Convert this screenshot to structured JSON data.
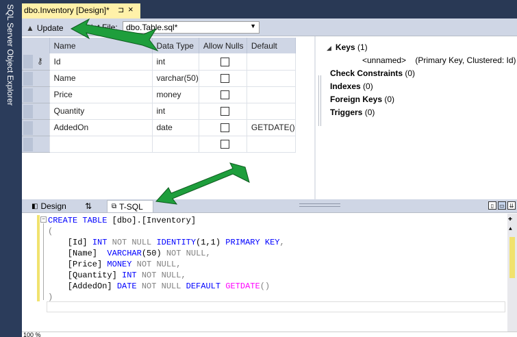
{
  "side_panel": {
    "title": "SQL Server Object Explorer"
  },
  "document_tab": {
    "title": "dbo.Inventory [Design]*",
    "pin_icon": "pin-icon",
    "close_icon": "close-icon"
  },
  "toolbar": {
    "update_label": "Update",
    "script_file_label": "Script File:",
    "script_file_value": "dbo.Table.sql*"
  },
  "design_grid": {
    "headers": [
      "Name",
      "Data Type",
      "Allow Nulls",
      "Default"
    ],
    "rows": [
      {
        "name": "Id",
        "type": "int",
        "allow_nulls": false,
        "default": "",
        "key": true
      },
      {
        "name": "Name",
        "type": "varchar(50)",
        "allow_nulls": false,
        "default": "",
        "key": false
      },
      {
        "name": "Price",
        "type": "money",
        "allow_nulls": false,
        "default": "",
        "key": false
      },
      {
        "name": "Quantity",
        "type": "int",
        "allow_nulls": false,
        "default": "",
        "key": false
      },
      {
        "name": "AddedOn",
        "type": "date",
        "allow_nulls": false,
        "default": "GETDATE()",
        "key": false
      },
      {
        "name": "",
        "type": "",
        "allow_nulls": false,
        "default": "",
        "key": false
      }
    ]
  },
  "properties": {
    "keys_label": "Keys",
    "keys_count": "(1)",
    "key_entry_name": "<unnamed>",
    "key_entry_desc": "(Primary Key, Clustered: Id)",
    "check_label": "Check Constraints",
    "check_count": "(0)",
    "indexes_label": "Indexes",
    "indexes_count": "(0)",
    "fk_label": "Foreign Keys",
    "fk_count": "(0)",
    "triggers_label": "Triggers",
    "triggers_count": "(0)"
  },
  "bottom_tabs": {
    "design": "Design",
    "swap": "⇅",
    "tsql": "T-SQL"
  },
  "code": {
    "line1_kw": "CREATE TABLE",
    "line1_rest": " [dbo].[Inventory]",
    "line2": "(",
    "l3_col": "    [Id] ",
    "l3_type": "INT",
    "l3_null": " NOT NULL ",
    "l3_ident": "IDENTITY",
    "l3_args": "(1,1) ",
    "l3_pk": "PRIMARY KEY",
    "l3_end": ",",
    "l4_col": "    [Name]  ",
    "l4_type": "VARCHAR",
    "l4_args": "(50)",
    "l4_null": " NOT NULL,",
    "l5_col": "    [Price] ",
    "l5_type": "MONEY",
    "l5_null": " NOT NULL,",
    "l6_col": "    [Quantity] ",
    "l6_type": "INT",
    "l6_null": " NOT NULL,",
    "l7_col": "    [AddedOn] ",
    "l7_type": "DATE",
    "l7_null": " NOT NULL ",
    "l7_default": "DEFAULT",
    "l7_fn": " GETDATE",
    "l7_end": "()",
    "line8": ")"
  },
  "status": {
    "zoom": "100 %"
  },
  "colors": {
    "accent": "#293955",
    "tab_active": "#fff1a9",
    "annotation_arrow": "#1e9e3c"
  }
}
